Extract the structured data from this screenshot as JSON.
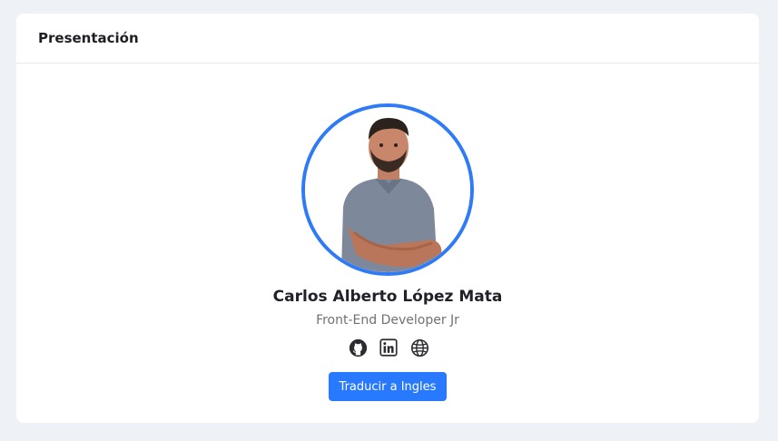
{
  "card": {
    "title": "Presentación"
  },
  "profile": {
    "name": "Carlos Alberto López Mata",
    "role": "Front-End Developer Jr",
    "avatar_icon": "profile-photo"
  },
  "socials": [
    {
      "icon": "github-icon"
    },
    {
      "icon": "linkedin-icon"
    },
    {
      "icon": "globe-icon"
    }
  ],
  "actions": {
    "translate_label": "Traducir a Ingles"
  },
  "colors": {
    "accent": "#2979ff",
    "avatar_border": "#2f7bf6",
    "background": "#eef2f6"
  }
}
